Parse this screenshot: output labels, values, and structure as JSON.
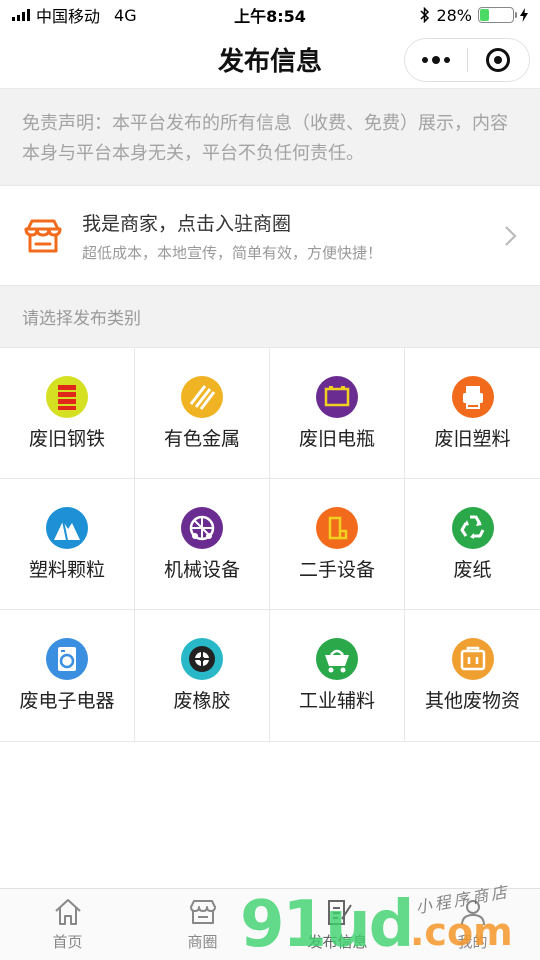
{
  "status_bar": {
    "carrier": "中国移动",
    "network": "4G",
    "time": "上午8:54",
    "battery_percent": "28%",
    "battery_level": 0.28
  },
  "nav": {
    "title": "发布信息"
  },
  "disclaimer": {
    "text": "免责声明：本平台发布的所有信息（收费、免费）展示，内容本身与平台本身无关，平台不负任何责任。"
  },
  "merchant_banner": {
    "title": "我是商家，点击入驻商圈",
    "subtitle": "超低成本，本地宣传，简单有效，方便快捷！",
    "icon": "shop-icon",
    "accent_color": "#f26b1d"
  },
  "section": {
    "label": "请选择发布类别"
  },
  "categories": [
    {
      "label": "废旧钢铁",
      "icon": "steel-icon",
      "color": "#d4e021"
    },
    {
      "label": "有色金属",
      "icon": "metal-icon",
      "color": "#f0b323"
    },
    {
      "label": "废旧电瓶",
      "icon": "battery-icon",
      "color": "#6a2c91"
    },
    {
      "label": "废旧塑料",
      "icon": "plastic-icon",
      "color": "#f26b1d"
    },
    {
      "label": "塑料颗粒",
      "icon": "pellet-icon",
      "color": "#1e90d6"
    },
    {
      "label": "机械设备",
      "icon": "machine-icon",
      "color": "#6a2c91"
    },
    {
      "label": "二手设备",
      "icon": "secondhand-icon",
      "color": "#f26b1d"
    },
    {
      "label": "废纸",
      "icon": "recycle-icon",
      "color": "#2aa84a"
    },
    {
      "label": "废电子电器",
      "icon": "washer-icon",
      "color": "#3a8fe0"
    },
    {
      "label": "废橡胶",
      "icon": "tire-icon",
      "color": "#29b8c8"
    },
    {
      "label": "工业辅料",
      "icon": "cart-icon",
      "color": "#2aa84a"
    },
    {
      "label": "其他废物资",
      "icon": "box-icon",
      "color": "#f0a030"
    }
  ],
  "tab_bar": {
    "tabs": [
      {
        "label": "首页",
        "icon": "home-icon"
      },
      {
        "label": "商圈",
        "icon": "store-icon"
      },
      {
        "label": "发布信息",
        "icon": "edit-icon",
        "active": true
      },
      {
        "label": "我的",
        "icon": "user-icon"
      }
    ]
  },
  "watermark": {
    "text": "91ud",
    "suffix": ".com",
    "tagline": "小程序商店"
  }
}
